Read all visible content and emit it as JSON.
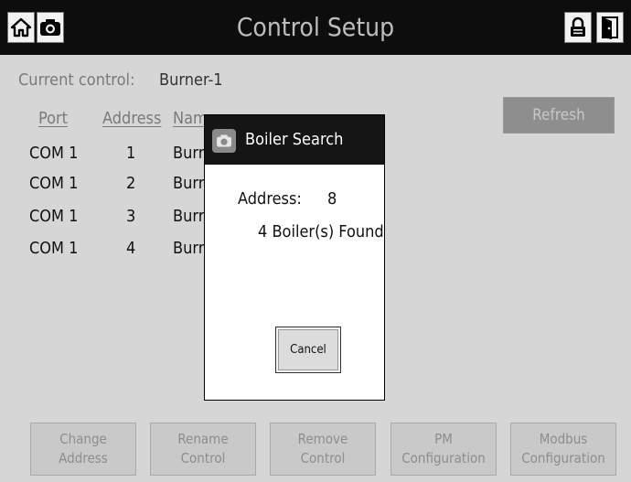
{
  "header": {
    "title": "Control Setup"
  },
  "current_control": {
    "label": "Current control:",
    "value": "Burner-1"
  },
  "table": {
    "headers": [
      "Port",
      "Address",
      "Nam"
    ],
    "rows": [
      {
        "port": "COM 1",
        "address": "1",
        "name": "Burr"
      },
      {
        "port": "COM 1",
        "address": "2",
        "name": "Burr"
      },
      {
        "port": "COM 1",
        "address": "3",
        "name": "Burr"
      },
      {
        "port": "COM 1",
        "address": "4",
        "name": "Burr"
      }
    ]
  },
  "refresh_label": "Refresh",
  "buttons": [
    {
      "line1": "Change",
      "line2": "Address"
    },
    {
      "line1": "Rename",
      "line2": "Control"
    },
    {
      "line1": "Remove",
      "line2": "Control"
    },
    {
      "line1": "PM",
      "line2": "Configuration"
    },
    {
      "line1": "Modbus",
      "line2": "Configuration"
    }
  ],
  "dialog": {
    "title": "Boiler Search",
    "address_label": "Address:",
    "address_value": "8",
    "found": "4 Boiler(s) Found",
    "cancel": "Cancel"
  },
  "icons": [
    "home-icon",
    "camera-icon",
    "lock-icon",
    "exit-icon"
  ]
}
